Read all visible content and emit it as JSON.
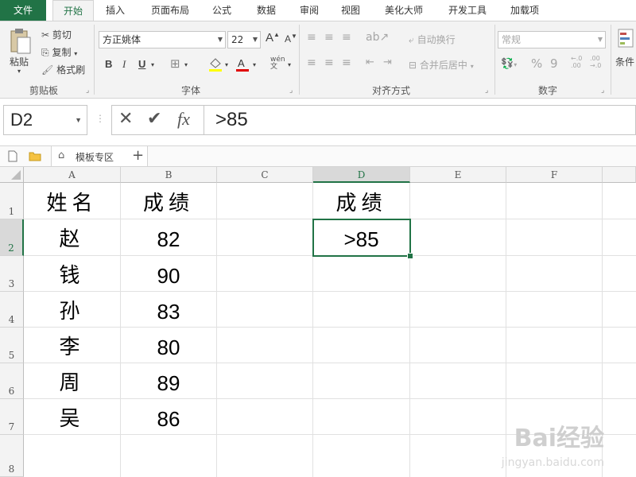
{
  "ribbon_tabs": [
    "文件",
    "开始",
    "插入",
    "页面布局",
    "公式",
    "数据",
    "审阅",
    "视图",
    "美化大师",
    "开发工具",
    "加载项"
  ],
  "clipboard": {
    "paste": "粘贴",
    "cut": "剪切",
    "copy": "复制",
    "format_painter": "格式刷",
    "label": "剪贴板"
  },
  "font": {
    "name": "方正姚体",
    "size": "22",
    "grow": "A",
    "shrink": "A",
    "bold": "B",
    "italic": "I",
    "underline": "U",
    "label": "字体",
    "phonetic": "wén"
  },
  "alignment": {
    "wrap": "自动换行",
    "merge": "合并后居中",
    "label": "对齐方式"
  },
  "number": {
    "format": "常规",
    "percent": "%",
    "comma": "9",
    "label": "数字",
    "inc_decimal": "←.0\n.00",
    "dec_decimal": ".00\n→.0"
  },
  "styles": {
    "conditional": "条件"
  },
  "formula_bar": {
    "name_box": "D2",
    "cancel": "✕",
    "enter": "✔",
    "fx": "fx",
    "formula": ">85"
  },
  "sheet_strip": {
    "template_area": "模板专区",
    "add": "+"
  },
  "columns": [
    "A",
    "B",
    "C",
    "D",
    "E",
    "F"
  ],
  "rows": [
    "1",
    "2",
    "3",
    "4",
    "5",
    "6",
    "7",
    "8"
  ],
  "cells": {
    "A1": "姓名",
    "B1": "成绩",
    "D1": "成绩",
    "A2": "赵",
    "B2": "82",
    "D2": ">85",
    "A3": "钱",
    "B3": "90",
    "A4": "孙",
    "B4": "83",
    "A5": "李",
    "B5": "80",
    "A6": "周",
    "B6": "89",
    "A7": "吴",
    "B7": "86"
  },
  "watermark": {
    "brand": "Bai经验",
    "url": "jingyan.baidu.com"
  },
  "colors": {
    "accent": "#217346",
    "ribbon": "#f3f3f3",
    "grid": "#e1e1e1"
  }
}
